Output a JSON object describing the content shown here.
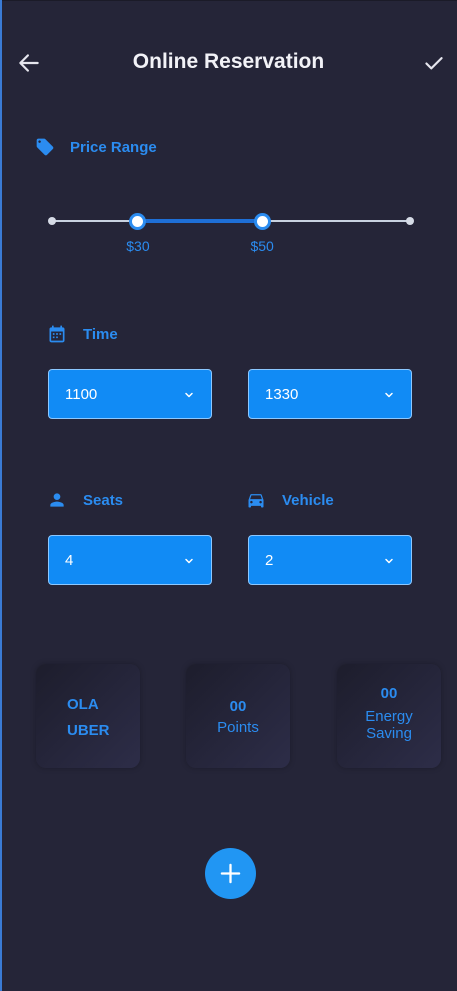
{
  "appbar": {
    "title": "Online Reservation",
    "back_icon": "arrow-left-icon",
    "confirm_icon": "check-icon"
  },
  "price_range": {
    "label": "Price Range",
    "icon": "tag-icon",
    "min_label": "$30",
    "max_label": "$50",
    "min_fraction": 0.243,
    "max_fraction": 0.586
  },
  "time": {
    "label": "Time",
    "icon": "calendar-icon",
    "start_value": "1100",
    "end_value": "1330"
  },
  "seats": {
    "label": "Seats",
    "icon": "person-icon",
    "value": "4"
  },
  "vehicle": {
    "label": "Vehicle",
    "icon": "car-icon",
    "value": "2"
  },
  "cards": {
    "providers": [
      "OLA",
      "UBER"
    ],
    "points_value": "00",
    "points_label": "Points",
    "energy_value": "00",
    "energy_label_line1": "Energy",
    "energy_label_line2": "Saving"
  },
  "colors": {
    "background": "#252538",
    "accent": "#2b8cf0",
    "dropdown": "#118bf5",
    "fab": "#2196f3"
  }
}
